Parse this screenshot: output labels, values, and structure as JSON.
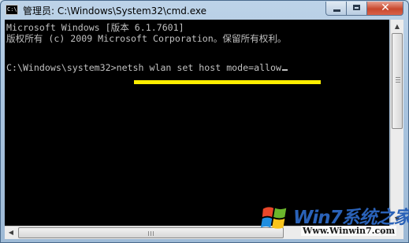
{
  "window": {
    "title": "管理员: C:\\Windows\\System32\\cmd.exe",
    "icon": "cmd-icon",
    "controls": {
      "minimize": "minimize-icon",
      "maximize": "maximize-icon",
      "close": "close-icon",
      "close_glyph": "✕"
    }
  },
  "console": {
    "lines": [
      "Microsoft Windows [版本 6.1.7601]",
      "版权所有 (c) 2009 Microsoft Corporation。保留所有权利。",
      "",
      "C:\\Windows\\system32>netsh wlan set host mode=allow"
    ],
    "highlight_color": "#ffee00",
    "text_color": "#c0c0c0",
    "background_color": "#000000"
  },
  "watermark": {
    "brand": "Win7系统之家",
    "url": "Www.Winwin7.com"
  }
}
